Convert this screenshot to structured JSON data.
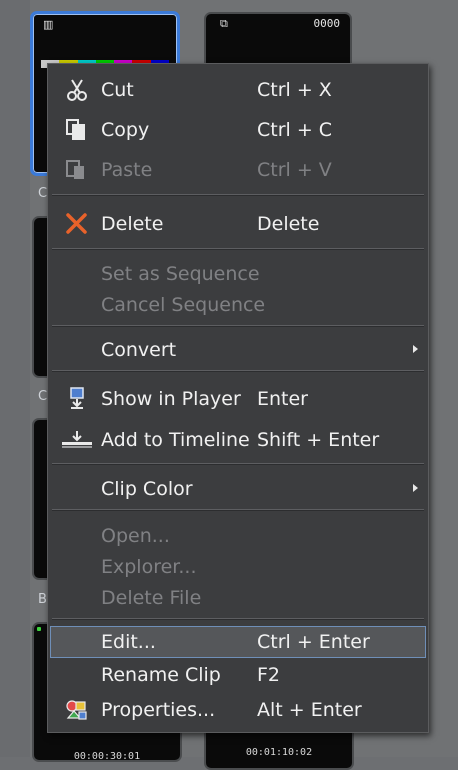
{
  "bin": {
    "thumbnails": [
      {
        "top_code": "0000"
      }
    ],
    "side_letters": [
      "C",
      "C",
      "B"
    ],
    "bottom_timecodes": [
      "00:00:30:01",
      "00:01:10:02"
    ]
  },
  "context_menu": {
    "items": [
      {
        "label": "Cut",
        "shortcut": "Ctrl + X",
        "icon": "scissors-icon",
        "enabled": true
      },
      {
        "label": "Copy",
        "shortcut": "Ctrl + C",
        "icon": "copy-icon",
        "enabled": true
      },
      {
        "label": "Paste",
        "shortcut": "Ctrl + V",
        "icon": "paste-icon",
        "enabled": false
      },
      {
        "label": "Delete",
        "shortcut": "Delete",
        "icon": "delete-x-icon",
        "enabled": true
      },
      {
        "label": "Set as Sequence",
        "shortcut": "",
        "enabled": false
      },
      {
        "label": "Cancel Sequence",
        "shortcut": "",
        "enabled": false
      },
      {
        "label": "Convert",
        "shortcut": "",
        "submenu": true,
        "enabled": true
      },
      {
        "label": "Show in Player",
        "shortcut": "Enter",
        "icon": "player-icon",
        "enabled": true
      },
      {
        "label": "Add to Timeline",
        "shortcut": "Shift + Enter",
        "icon": "timeline-icon",
        "enabled": true
      },
      {
        "label": "Clip Color",
        "shortcut": "",
        "submenu": true,
        "enabled": true
      },
      {
        "label": "Open...",
        "shortcut": "",
        "enabled": false
      },
      {
        "label": "Explorer...",
        "shortcut": "",
        "enabled": false
      },
      {
        "label": "Delete File",
        "shortcut": "",
        "enabled": false
      },
      {
        "label": "Edit...",
        "shortcut": "Ctrl + Enter",
        "enabled": true,
        "highlighted": true
      },
      {
        "label": "Rename Clip",
        "shortcut": "F2",
        "enabled": true
      },
      {
        "label": "Properties...",
        "shortcut": "Alt + Enter",
        "icon": "properties-icon",
        "enabled": true
      }
    ]
  },
  "colors": {
    "menu_bg": "#3c3d3f",
    "text": "#f1f1f1",
    "disabled_text": "#808184",
    "delete_icon": "#e8622a",
    "selection_border": "#3b7ad8"
  }
}
